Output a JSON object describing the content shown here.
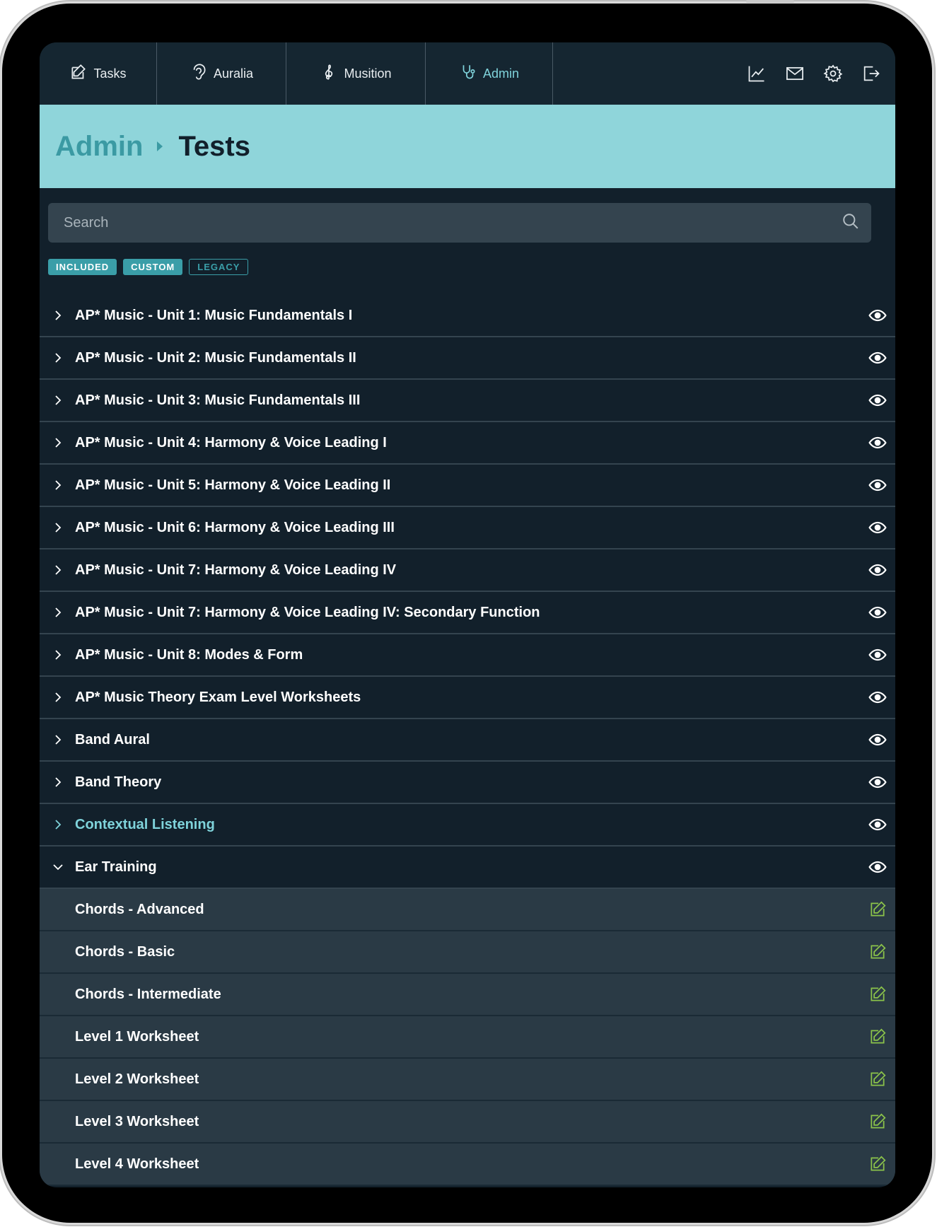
{
  "nav": {
    "tabs": [
      {
        "label": "Tasks",
        "icon": "edit-icon",
        "active": false
      },
      {
        "label": "Auralia",
        "icon": "ear-icon",
        "active": false
      },
      {
        "label": "Musition",
        "icon": "treble-clef-icon",
        "active": false
      },
      {
        "label": "Admin",
        "icon": "stethoscope-icon",
        "active": true
      }
    ],
    "actions": [
      "chart-icon",
      "mail-icon",
      "gear-icon",
      "logout-icon"
    ]
  },
  "header": {
    "parent": "Admin",
    "current": "Tests"
  },
  "search": {
    "placeholder": "Search",
    "value": ""
  },
  "filters": [
    {
      "label": "INCLUDED",
      "active": true
    },
    {
      "label": "CUSTOM",
      "active": true
    },
    {
      "label": "LEGACY",
      "active": false
    }
  ],
  "tests": [
    {
      "label": "AP* Music - Unit 1: Music Fundamentals I"
    },
    {
      "label": "AP* Music - Unit 2: Music Fundamentals II"
    },
    {
      "label": "AP* Music - Unit 3: Music Fundamentals III"
    },
    {
      "label": "AP* Music - Unit 4: Harmony & Voice Leading I"
    },
    {
      "label": "AP* Music - Unit 5: Harmony & Voice Leading II"
    },
    {
      "label": "AP* Music - Unit 6: Harmony & Voice Leading III"
    },
    {
      "label": "AP* Music - Unit 7: Harmony & Voice Leading IV"
    },
    {
      "label": "AP* Music - Unit 7: Harmony & Voice Leading IV: Secondary Function"
    },
    {
      "label": "AP* Music - Unit 8: Modes & Form"
    },
    {
      "label": "AP* Music Theory Exam Level Worksheets"
    },
    {
      "label": "Band Aural"
    },
    {
      "label": "Band Theory"
    },
    {
      "label": "Contextual Listening",
      "highlight": true
    },
    {
      "label": "Ear Training",
      "expanded": true,
      "children": [
        {
          "label": "Chords - Advanced"
        },
        {
          "label": "Chords - Basic"
        },
        {
          "label": "Chords - Intermediate"
        },
        {
          "label": "Level 1 Worksheet"
        },
        {
          "label": "Level 2 Worksheet"
        },
        {
          "label": "Level 3 Worksheet"
        },
        {
          "label": "Level 4 Worksheet"
        }
      ]
    }
  ],
  "colors": {
    "background": "#12202b",
    "header_band": "#8fd5da",
    "accent": "#3a9ea8",
    "accent_light": "#7fd3db",
    "edit_icon": "#8bc34a"
  }
}
